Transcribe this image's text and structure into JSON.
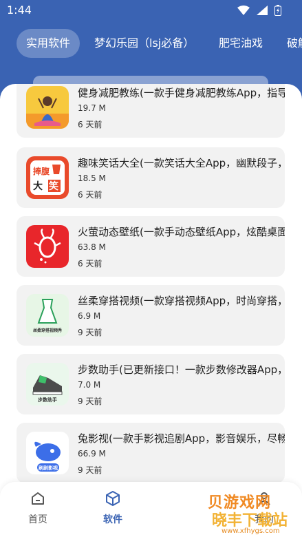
{
  "status_bar": {
    "time": "1:44"
  },
  "tabs": [
    {
      "label": "实用软件",
      "active": true
    },
    {
      "label": "梦幻乐园（lsj必备）",
      "active": false
    },
    {
      "label": "肥宅油戏",
      "active": false
    },
    {
      "label": "破解",
      "active": false
    }
  ],
  "apps": [
    {
      "title": "健身减肥教练(一款手健身减肥教练App，指导，",
      "size": "19.7 M",
      "time": "6 天前",
      "icon": "fitness-icon"
    },
    {
      "title": "趣味笑话大全(一款笑话大全App，幽默段子，乐",
      "size": "18.5 M",
      "time": "6 天前",
      "icon": "joke-icon",
      "icon_text": [
        "捧腹",
        "大",
        "笑"
      ]
    },
    {
      "title": "火萤动态壁纸(一款手动态壁纸App，炫酷桌面，",
      "size": "63.8 M",
      "time": "6 天前",
      "icon": "firefly-icon"
    },
    {
      "title": "丝柔穿搭视频(一款穿搭视频App，时尚穿搭，动",
      "size": "6.9 M",
      "time": "9 天前",
      "icon": "dress-icon",
      "icon_text": [
        "丝柔穿搭视频秀"
      ]
    },
    {
      "title": "步数助手(已更新接口！一款步数修改器App，自",
      "size": "7.0 M",
      "time": "9 天前",
      "icon": "sneaker-icon",
      "icon_text": [
        "步数助手"
      ]
    },
    {
      "title": "兔影视(一款手影视追剧App，影音娱乐，尽畅享",
      "size": "66.9 M",
      "time": "9 天前",
      "icon": "rabbit-icon",
      "icon_text": [
        "刷剧影视"
      ]
    }
  ],
  "bottom_nav": [
    {
      "label": "首页",
      "icon": "home-icon",
      "active": false
    },
    {
      "label": "软件",
      "icon": "cube-icon",
      "active": true
    },
    {
      "label": "我的",
      "icon": "user-icon",
      "active": false
    }
  ],
  "watermark": {
    "line1": "贝游戏网",
    "line2": "晓丰下载站",
    "line3": "www.xfhygs.com"
  },
  "colors": {
    "primary": "#3a63b3",
    "card_bg": "#f2f2f2",
    "joke_red": "#e94a2b",
    "firefly_red": "#e8262b"
  }
}
